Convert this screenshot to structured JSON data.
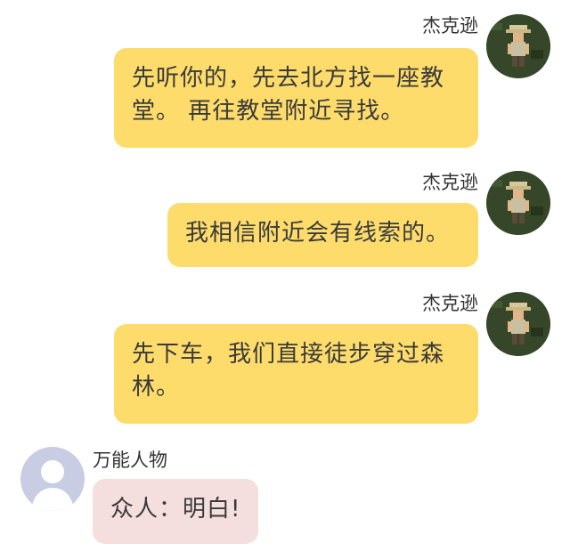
{
  "messages": [
    {
      "sender": "杰克逊",
      "text": "先听你的，先去北方找一座教堂。 再往教堂附近寻找。",
      "lines": [
        "先听你的，先去北方找一座教",
        "堂。 再往教堂附近寻找。"
      ],
      "side": "right",
      "avatar": "character-avatar"
    },
    {
      "sender": "杰克逊",
      "text": "我相信附近会有线索的。",
      "lines": [
        "我相信附近会有线索的。"
      ],
      "side": "right",
      "avatar": "character-avatar"
    },
    {
      "sender": "杰克逊",
      "text": "先下车，我们直接徒步穿过森林。",
      "lines": [
        "先下车，我们直接徒步穿过森",
        "林。"
      ],
      "side": "right",
      "avatar": "character-avatar"
    },
    {
      "sender": "万能人物",
      "text": "众人：明白!",
      "lines": [
        "众人：明白!"
      ],
      "side": "left",
      "avatar": "default-user-avatar"
    }
  ],
  "colors": {
    "right_bubble": "#fddc6c",
    "left_bubble": "#f4dede",
    "default_avatar_bg": "#c9cde3",
    "character_avatar_bg": "#2f3f24"
  }
}
